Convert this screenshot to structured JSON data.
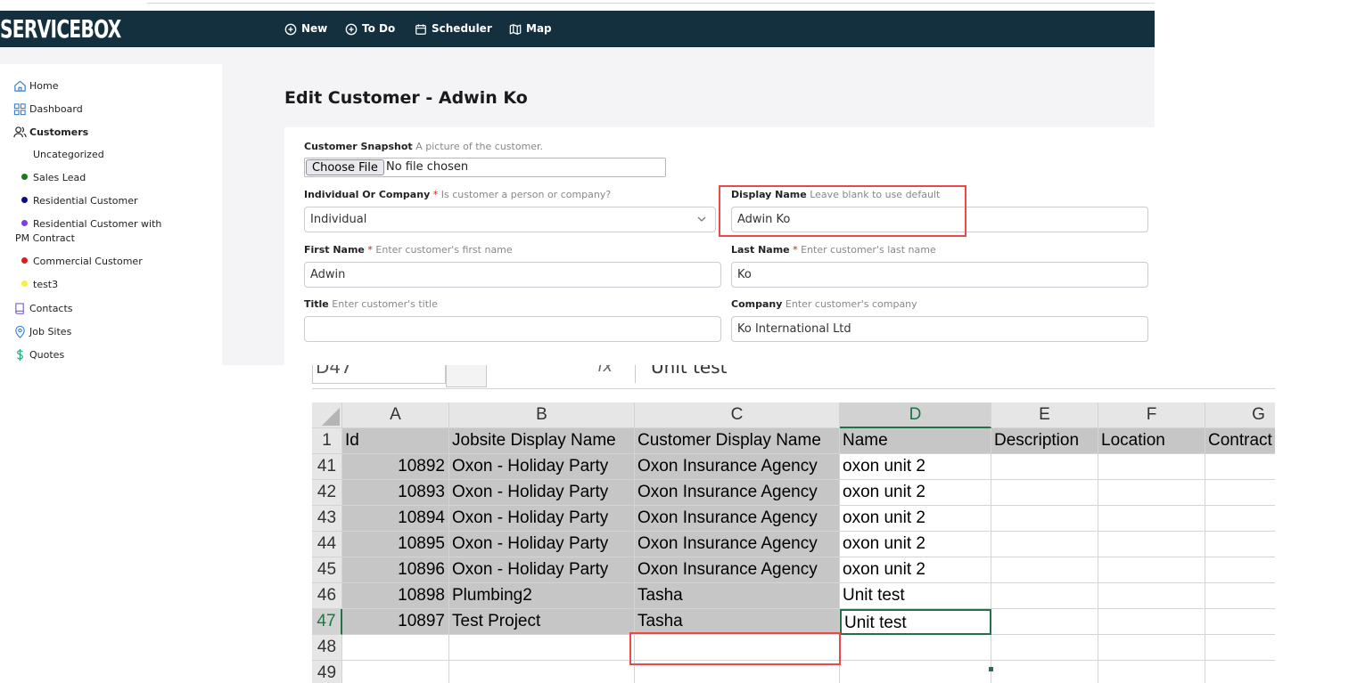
{
  "app": {
    "logo": "SERVICEBOX",
    "nav": [
      {
        "label": "New",
        "icon": "plus-circle-icon"
      },
      {
        "label": "To Do",
        "icon": "plus-circle-icon"
      },
      {
        "label": "Scheduler",
        "icon": "calendar-icon"
      },
      {
        "label": "Map",
        "icon": "map-icon"
      }
    ]
  },
  "sidebar": {
    "home": "Home",
    "dashboard": "Dashboard",
    "customers": "Customers",
    "sub": [
      {
        "label": "Uncategorized",
        "color": ""
      },
      {
        "label": "Sales Lead",
        "color": "#1a7a1a"
      },
      {
        "label": "Residential Customer",
        "color": "#0b0b8a"
      },
      {
        "label": "Residential Customer with",
        "label2": "PM Contract",
        "color": "#7b3fe4"
      },
      {
        "label": "Commercial Customer",
        "color": "#e31b1b"
      },
      {
        "label": "test3",
        "color": "#f5f23a"
      }
    ],
    "contacts": "Contacts",
    "job_sites": "Job Sites",
    "quotes": "Quotes"
  },
  "form": {
    "title": "Edit Customer - Adwin Ko",
    "snapshot": {
      "label": "Customer Snapshot",
      "hint": "A picture of the customer.",
      "button": "Choose File",
      "status": "No file chosen"
    },
    "individual": {
      "label": "Individual Or Company",
      "required": "*",
      "hint": "Is customer a person or company?",
      "value": "Individual"
    },
    "display_name": {
      "label": "Display Name",
      "hint": "Leave blank to use default",
      "value": "Adwin Ko"
    },
    "first_name": {
      "label": "First Name",
      "required": "*",
      "hint": "Enter customer's first name",
      "value": "Adwin"
    },
    "last_name": {
      "label": "Last Name",
      "required": "*",
      "hint": "Enter customer's last name",
      "value": "Ko"
    },
    "title_field": {
      "label": "Title",
      "hint": "Enter customer's title",
      "value": ""
    },
    "company": {
      "label": "Company",
      "hint": "Enter customer's company",
      "value": "Ko International Ltd"
    }
  },
  "sheet": {
    "name_box": "D47",
    "fx": "fx",
    "formula_value": "Unit test",
    "columns": [
      "A",
      "B",
      "C",
      "D",
      "E",
      "F",
      "G"
    ],
    "headers": [
      "Id",
      "Jobsite Display Name",
      "Customer Display Name",
      "Name",
      "Description",
      "Location",
      "Contract"
    ],
    "rows": [
      {
        "n": "41",
        "id": "10892",
        "jobsite": "Oxon - Holiday Party",
        "customer": "Oxon Insurance Agency",
        "name": "oxon unit 2"
      },
      {
        "n": "42",
        "id": "10893",
        "jobsite": "Oxon - Holiday Party",
        "customer": "Oxon Insurance Agency",
        "name": "oxon unit 2"
      },
      {
        "n": "43",
        "id": "10894",
        "jobsite": "Oxon - Holiday Party",
        "customer": "Oxon Insurance Agency",
        "name": "oxon unit 2"
      },
      {
        "n": "44",
        "id": "10895",
        "jobsite": "Oxon - Holiday Party",
        "customer": "Oxon Insurance Agency",
        "name": "oxon unit 2"
      },
      {
        "n": "45",
        "id": "10896",
        "jobsite": "Oxon - Holiday Party",
        "customer": "Oxon Insurance Agency",
        "name": "oxon unit 2"
      },
      {
        "n": "46",
        "id": "10898",
        "jobsite": "Plumbing2",
        "customer": "Tasha",
        "name": "Unit test"
      },
      {
        "n": "47",
        "id": "10897",
        "jobsite": "Test Project",
        "customer": "Tasha",
        "name": "Unit test"
      },
      {
        "n": "48",
        "id": "",
        "jobsite": "",
        "customer": "",
        "name": ""
      },
      {
        "n": "49",
        "id": "",
        "jobsite": "",
        "customer": "",
        "name": ""
      }
    ],
    "header_row_num": "1"
  }
}
